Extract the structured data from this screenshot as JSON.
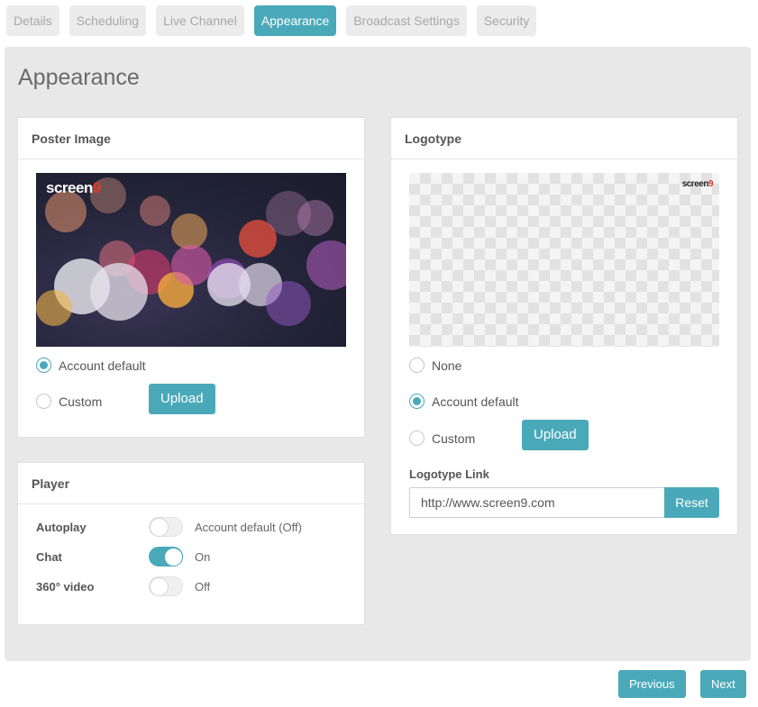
{
  "tabs": [
    {
      "label": "Details",
      "active": false
    },
    {
      "label": "Scheduling",
      "active": false
    },
    {
      "label": "Live Channel",
      "active": false
    },
    {
      "label": "Appearance",
      "active": true
    },
    {
      "label": "Broadcast Settings",
      "active": false
    },
    {
      "label": "Security",
      "active": false
    }
  ],
  "page_title": "Appearance",
  "poster": {
    "header": "Poster Image",
    "logo_text": "screen",
    "logo_suffix": "9",
    "options": [
      {
        "label": "Account default",
        "checked": true
      },
      {
        "label": "Custom",
        "checked": false
      }
    ],
    "upload_label": "Upload"
  },
  "logotype": {
    "header": "Logotype",
    "logo_text": "screen",
    "logo_suffix": "9",
    "options": [
      {
        "label": "None",
        "checked": false
      },
      {
        "label": "Account default",
        "checked": true
      },
      {
        "label": "Custom",
        "checked": false
      }
    ],
    "upload_label": "Upload",
    "link_label": "Logotype Link",
    "link_value": "http://www.screen9.com",
    "reset_label": "Reset"
  },
  "player": {
    "header": "Player",
    "rows": [
      {
        "label": "Autoplay",
        "on": false,
        "value": "Account default (Off)"
      },
      {
        "label": "Chat",
        "on": true,
        "value": "On"
      },
      {
        "label": "360° video",
        "on": false,
        "value": "Off"
      }
    ]
  },
  "footer": {
    "previous_label": "Previous",
    "next_label": "Next"
  },
  "colors": {
    "accent": "#4aa9b9",
    "logo_red": "#e03a2f",
    "panel_bg": "#e8e8e8"
  }
}
